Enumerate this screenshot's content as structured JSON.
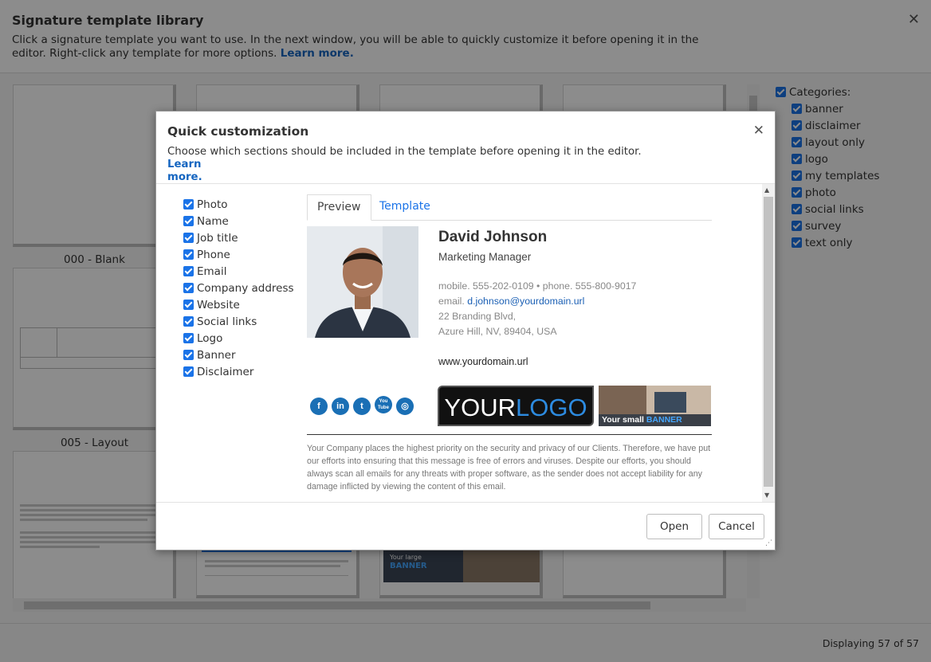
{
  "library": {
    "title": "Signature template library",
    "description": "Click a signature template you want to use. In the next window, you will be able to quickly customize it before opening it in the editor. Right-click any template for more options.",
    "learn_more": "Learn more.",
    "thumb_labels": [
      "000 - Blank",
      "005 - Layout"
    ],
    "thumb_banner_label": "Your large",
    "thumb_banner_word": "BANNER",
    "categories_label": "Categories:",
    "categories": [
      "banner",
      "disclaimer",
      "layout only",
      "logo",
      "my templates",
      "photo",
      "social links",
      "survey",
      "text only"
    ],
    "displaying": "Displaying 57 of 57"
  },
  "modal": {
    "title": "Quick customization",
    "description": "Choose which sections should be included in the template before opening it in the editor.",
    "learn_more_1": "Learn",
    "learn_more_2": "more.",
    "sections": [
      "Photo",
      "Name",
      "Job title",
      "Phone",
      "Email",
      "Company address",
      "Website",
      "Social links",
      "Logo",
      "Banner",
      "Disclaimer"
    ],
    "tabs": {
      "preview": "Preview",
      "template": "Template"
    },
    "open_label": "Open",
    "cancel_label": "Cancel"
  },
  "signature": {
    "name": "David Johnson",
    "job_title": "Marketing Manager",
    "phones": "mobile. 555-202-0109 • phone. 555-800-9017",
    "email_label": "email.",
    "email": "d.johnson@yourdomain.url",
    "address1": "22 Branding Blvd,",
    "address2": "Azure Hill, NV, 89404, USA",
    "website": "www.yourdomain.url",
    "logo_text_1": "YOUR",
    "logo_text_2": "LOGO",
    "banner_text_1": "Your small",
    "banner_text_2": "BANNER",
    "social": [
      {
        "icon": "facebook-icon",
        "glyph": "f"
      },
      {
        "icon": "linkedin-icon",
        "glyph": "in"
      },
      {
        "icon": "twitter-icon",
        "glyph": "t"
      },
      {
        "icon": "youtube-icon",
        "glyph": "You Tube"
      },
      {
        "icon": "instagram-icon",
        "glyph": "◎"
      }
    ],
    "disclaimer": "Your Company places the highest priority on the security and privacy of our Clients. Therefore, we have put our efforts into ensuring that this message is free of errors and viruses. Despite our efforts, you should always scan all emails for any threats with proper software, as the sender does not accept liability for any damage inflicted by viewing the content of this email."
  },
  "colors": {
    "accent": "#1a73e8",
    "link": "#1565c0",
    "logo_accent": "#2d8be0",
    "social": "#1a6fb5"
  }
}
